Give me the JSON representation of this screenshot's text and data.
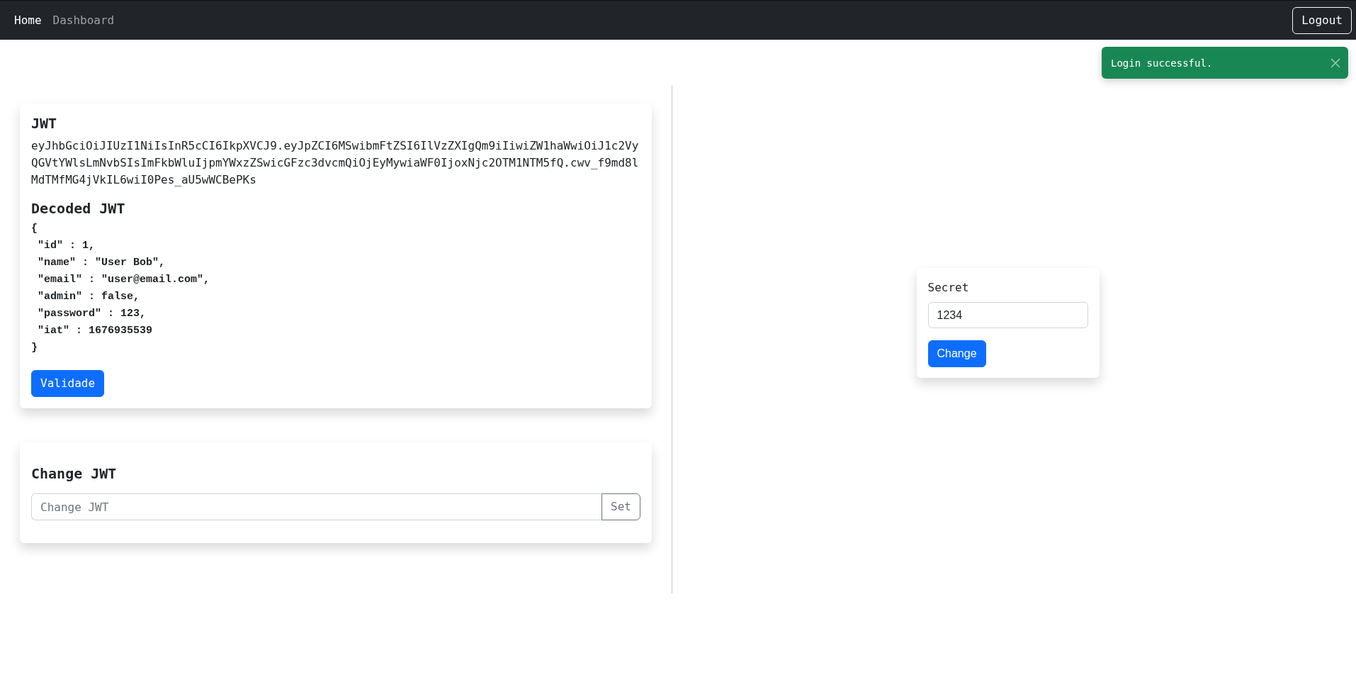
{
  "navbar": {
    "links": [
      {
        "label": "Home",
        "selected": true
      },
      {
        "label": "Dashboard",
        "selected": false
      }
    ],
    "logout_button": "Logout"
  },
  "toast": {
    "message": "Login successful."
  },
  "jwt_card": {
    "title": "JWT",
    "token": "eyJhbGciOiJIUzI1NiIsInR5cCI6IkpXVCJ9.eyJpZCI6MSwibmFtZSI6IlVzZXIgQm9iIiwiZW1haWwiOiJ1c2VyQGVtYWlsLmNvbSIsImFkbWluIjpmYWxzZSwicGFzc3dvcmQiOjEyMywiaWF0IjoxNjc2OTM1NTM5fQ.cwv_f9md8lMdTMfMG4jVkIL6wiI0Pes_aU5wWCBePKs",
    "decoded_title": "Decoded JWT",
    "decoded_lines": [
      "{",
      " \"id\" : 1,",
      " \"name\" : \"User Bob\",",
      " \"email\" : \"user@email.com\",",
      " \"admin\" : false,",
      " \"password\" : 123,",
      " \"iat\" : 1676935539",
      "}"
    ],
    "validate_button": "Validade"
  },
  "change_jwt_card": {
    "title": "Change JWT",
    "input": {
      "placeholder": "Change JWT"
    },
    "button": "Set"
  },
  "secret_card": {
    "label": "Secret",
    "input": {
      "value": "1234"
    },
    "button": "Change"
  }
}
